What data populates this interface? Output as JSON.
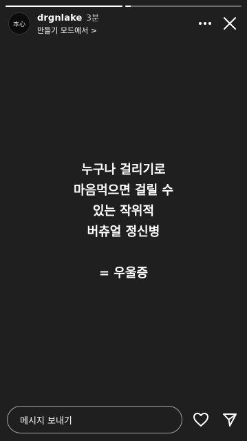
{
  "story": {
    "progress": [
      1.0,
      0.05
    ],
    "username": "drgnlake",
    "time_ago": "3분",
    "subtitle": "만들기 모드에서 >",
    "avatar_text": "本心"
  },
  "content": {
    "lines": [
      "누구나 걸리기로",
      "마음먹으면 걸릴 수",
      "있는 작위적",
      "버츄얼 정신병"
    ],
    "conclusion": "= 우울증"
  },
  "footer": {
    "message_placeholder": "메시지 보내기"
  },
  "icons": {
    "more": "more-horizontal-icon",
    "close": "close-icon",
    "like": "heart-icon",
    "send": "send-icon"
  }
}
